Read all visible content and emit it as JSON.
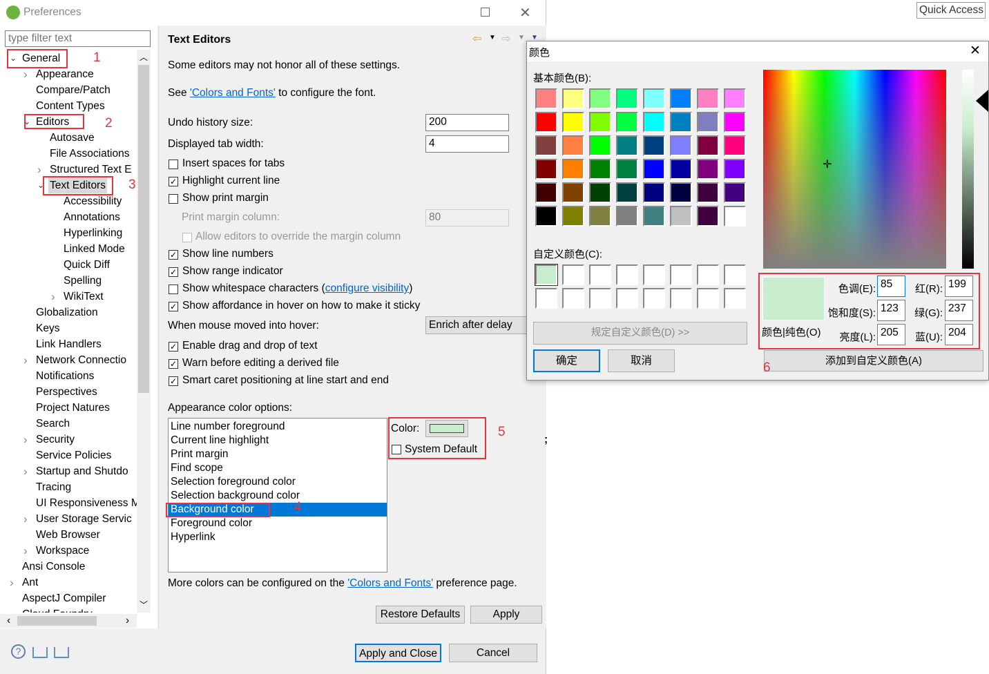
{
  "window": {
    "title": "Preferences",
    "filter_placeholder": "type filter text"
  },
  "quick_access": "Quick Access",
  "tree": [
    {
      "label": "General",
      "level": 0,
      "exp": "open"
    },
    {
      "label": "Appearance",
      "level": 1,
      "exp": "closed"
    },
    {
      "label": "Compare/Patch",
      "level": 1,
      "exp": "none"
    },
    {
      "label": "Content Types",
      "level": 1,
      "exp": "none"
    },
    {
      "label": "Editors",
      "level": 1,
      "exp": "open"
    },
    {
      "label": "Autosave",
      "level": 2,
      "exp": "none"
    },
    {
      "label": "File Associations",
      "level": 2,
      "exp": "none"
    },
    {
      "label": "Structured Text E",
      "level": 2,
      "exp": "closed"
    },
    {
      "label": "Text Editors",
      "level": 2,
      "exp": "open",
      "selected": true
    },
    {
      "label": "Accessibility",
      "level": 3,
      "exp": "none"
    },
    {
      "label": "Annotations",
      "level": 3,
      "exp": "none"
    },
    {
      "label": "Hyperlinking",
      "level": 3,
      "exp": "none"
    },
    {
      "label": "Linked Mode",
      "level": 3,
      "exp": "none"
    },
    {
      "label": "Quick Diff",
      "level": 3,
      "exp": "none"
    },
    {
      "label": "Spelling",
      "level": 3,
      "exp": "none"
    },
    {
      "label": "WikiText",
      "level": 3,
      "exp": "closed"
    },
    {
      "label": "Globalization",
      "level": 1,
      "exp": "none"
    },
    {
      "label": "Keys",
      "level": 1,
      "exp": "none"
    },
    {
      "label": "Link Handlers",
      "level": 1,
      "exp": "none"
    },
    {
      "label": "Network Connectio",
      "level": 1,
      "exp": "closed"
    },
    {
      "label": "Notifications",
      "level": 1,
      "exp": "none"
    },
    {
      "label": "Perspectives",
      "level": 1,
      "exp": "none"
    },
    {
      "label": "Project Natures",
      "level": 1,
      "exp": "none"
    },
    {
      "label": "Search",
      "level": 1,
      "exp": "none"
    },
    {
      "label": "Security",
      "level": 1,
      "exp": "closed"
    },
    {
      "label": "Service Policies",
      "level": 1,
      "exp": "none"
    },
    {
      "label": "Startup and Shutdo",
      "level": 1,
      "exp": "closed"
    },
    {
      "label": "Tracing",
      "level": 1,
      "exp": "none"
    },
    {
      "label": "UI Responsiveness M",
      "level": 1,
      "exp": "none"
    },
    {
      "label": "User Storage Servic",
      "level": 1,
      "exp": "closed"
    },
    {
      "label": "Web Browser",
      "level": 1,
      "exp": "none"
    },
    {
      "label": "Workspace",
      "level": 1,
      "exp": "closed"
    },
    {
      "label": "Ansi Console",
      "level": 0,
      "exp": "none"
    },
    {
      "label": "Ant",
      "level": 0,
      "exp": "closed"
    },
    {
      "label": "AspectJ Compiler",
      "level": 0,
      "exp": "none"
    },
    {
      "label": "Cloud Foundry",
      "level": 0,
      "exp": "closed"
    }
  ],
  "page": {
    "title": "Text Editors",
    "note": "Some editors may not honor all of these settings.",
    "see_prefix": "See ",
    "see_link": "'Colors and Fonts'",
    "see_suffix": " to configure the font.",
    "undo_label": "Undo history size:",
    "undo_value": "200",
    "tab_label": "Displayed tab width:",
    "tab_value": "4",
    "options": [
      {
        "label": "Insert spaces for tabs",
        "checked": false
      },
      {
        "label": "Highlight current line",
        "checked": true
      },
      {
        "label": "Show print margin",
        "checked": false
      }
    ],
    "margin_label": "Print margin column:",
    "margin_value": "80",
    "override_label": "Allow editors to override the margin column",
    "options2": [
      {
        "label": "Show line numbers",
        "checked": true
      },
      {
        "label": "Show range indicator",
        "checked": true
      },
      {
        "label": "Show whitespace characters (",
        "checked": false,
        "link": "configure visibility",
        "after": ")"
      },
      {
        "label": "Show affordance in hover on how to make it sticky",
        "checked": true
      }
    ],
    "hover_label": "When mouse moved into hover:",
    "hover_value": "Enrich after delay",
    "options3": [
      {
        "label": "Enable drag and drop of text",
        "checked": true
      },
      {
        "label": "Warn before editing a derived file",
        "checked": true
      },
      {
        "label": "Smart caret positioning at line start and end",
        "checked": true
      }
    ],
    "appearance_label": "Appearance color options:",
    "color_items": [
      "Line number foreground",
      "Current line highlight",
      "Print margin",
      "Find scope",
      "Selection foreground color",
      "Selection background color",
      "Background color",
      "Foreground color",
      "Hyperlink"
    ],
    "selected_color_item": "Background color",
    "color_label": "Color:",
    "color_value": "#c7edcc",
    "system_default": "System Default",
    "more_prefix": "More colors can be configured on the ",
    "more_link": "'Colors and Fonts'",
    "more_suffix": " preference page.",
    "restore": "Restore Defaults",
    "apply": "Apply",
    "apply_close": "Apply and Close",
    "cancel": "Cancel"
  },
  "annotations": [
    "1",
    "2",
    "3",
    "4",
    "5",
    "6"
  ],
  "color_dialog": {
    "title": "颜色",
    "basic_label": "基本颜色(B):",
    "basic_colors": [
      "#ff8080",
      "#ffff80",
      "#80ff80",
      "#00ff80",
      "#80ffff",
      "#0080ff",
      "#ff80c0",
      "#ff80ff",
      "#ff0000",
      "#ffff00",
      "#80ff00",
      "#00ff40",
      "#00ffff",
      "#0080c0",
      "#8080c0",
      "#ff00ff",
      "#804040",
      "#ff8040",
      "#00ff00",
      "#008080",
      "#004080",
      "#8080ff",
      "#800040",
      "#ff0080",
      "#800000",
      "#ff8000",
      "#008000",
      "#008040",
      "#0000ff",
      "#0000a0",
      "#800080",
      "#8000ff",
      "#400000",
      "#804000",
      "#004000",
      "#004040",
      "#000080",
      "#000040",
      "#400040",
      "#400080",
      "#000000",
      "#808000",
      "#808040",
      "#808080",
      "#408080",
      "#c0c0c0",
      "#400040",
      "#ffffff"
    ],
    "custom_label": "自定义颜色(C):",
    "custom_colors": [
      "#c7edcc",
      "#ffffff",
      "#ffffff",
      "#ffffff",
      "#ffffff",
      "#ffffff",
      "#ffffff",
      "#ffffff",
      "#ffffff",
      "#ffffff",
      "#ffffff",
      "#ffffff",
      "#ffffff",
      "#ffffff",
      "#ffffff",
      "#ffffff"
    ],
    "define_custom": "规定自定义颜色(D) >>",
    "ok": "确定",
    "cancel": "取消",
    "solid_label": "颜色|纯色(O)",
    "hue_label": "色调(E):",
    "hue": "85",
    "sat_label": "饱和度(S):",
    "sat": "123",
    "lum_label": "亮度(L):",
    "lum": "205",
    "red_label": "红(R):",
    "red": "199",
    "green_label": "绿(G):",
    "green": "237",
    "blue_label": "蓝(U):",
    "blue": "204",
    "add_custom": "添加到自定义颜色(A)",
    "current_color": "#c7edcc"
  }
}
